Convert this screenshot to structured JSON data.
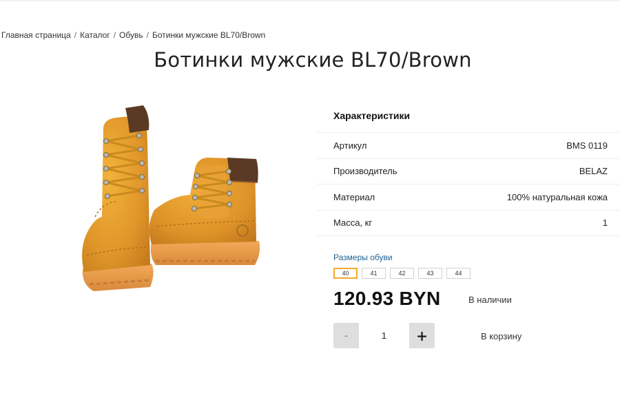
{
  "breadcrumb": {
    "items": [
      "Главная страница",
      "Каталог",
      "Обувь"
    ],
    "current": "Ботинки мужские BL70/Brown",
    "separator": "/"
  },
  "product": {
    "title": "Ботинки мужские BL70/Brown",
    "image_alt_icon": "boots-image"
  },
  "specs": {
    "heading": "Характеристики",
    "rows": [
      {
        "label": "Артикул",
        "value": "BMS 0119"
      },
      {
        "label": "Производитель",
        "value": "BELAZ"
      },
      {
        "label": "Материал",
        "value": "100% натуральная кожа"
      },
      {
        "label": "Масса, кг",
        "value": "1"
      }
    ]
  },
  "sizes": {
    "label": "Размеры обуви",
    "options": [
      "40",
      "41",
      "42",
      "43",
      "44"
    ],
    "selected": "40"
  },
  "price": {
    "value": "120.93 BYN",
    "stock": "В наличии"
  },
  "cart": {
    "minus_label": "-",
    "plus_label": "+",
    "quantity": "1",
    "add_label": "В корзину"
  },
  "colors": {
    "accent": "#f3a92b",
    "link": "#1a5f91",
    "boot_leather": "#e39a28",
    "boot_collar": "#5a3a25"
  }
}
